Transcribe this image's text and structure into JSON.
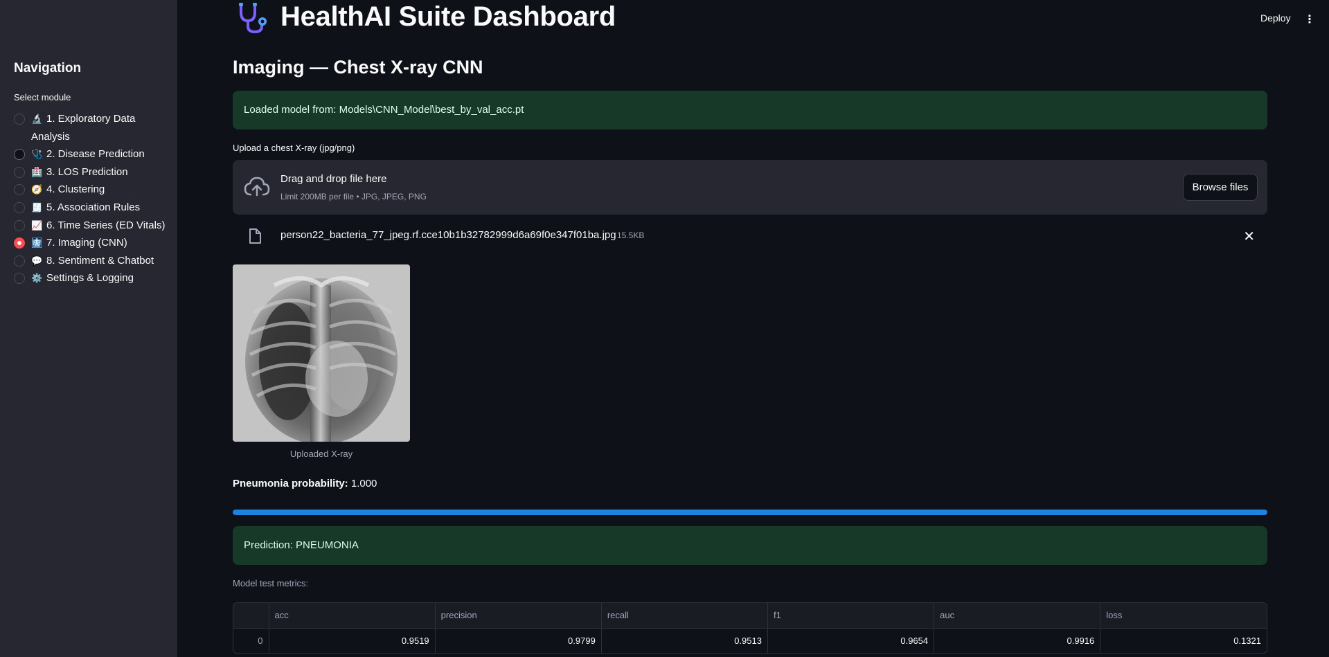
{
  "app": {
    "title": "HealthAI Suite Dashboard",
    "logo_icon": "stethoscope-icon",
    "deploy_label": "Deploy",
    "menu_icon": "kebab-menu-icon"
  },
  "sidebar": {
    "title": "Navigation",
    "select_label": "Select module",
    "selected_index": 6,
    "items": [
      {
        "emoji": "🔬",
        "label": "1. Exploratory Data Analysis"
      },
      {
        "emoji": "🩺",
        "label": "2. Disease Prediction"
      },
      {
        "emoji": "🏥",
        "label": "3. LOS Prediction"
      },
      {
        "emoji": "🧭",
        "label": "4. Clustering"
      },
      {
        "emoji": "🧾",
        "label": "5. Association Rules"
      },
      {
        "emoji": "📈",
        "label": "6. Time Series (ED Vitals)"
      },
      {
        "emoji": "🩻",
        "label": "7. Imaging (CNN)"
      },
      {
        "emoji": "💬",
        "label": "8. Sentiment & Chatbot"
      },
      {
        "emoji": "⚙️",
        "label": "Settings & Logging"
      }
    ]
  },
  "main": {
    "page_title": "Imaging — Chest X-ray CNN",
    "model_loaded_msg": "Loaded model from: Models\\CNN_Model\\best_by_val_acc.pt",
    "upload": {
      "label": "Upload a chest X-ray (jpg/png)",
      "dropzone_title": "Drag and drop file here",
      "dropzone_limit": "Limit 200MB per file • JPG, JPEG, PNG",
      "browse_label": "Browse files",
      "file_name": "person22_bacteria_77_jpeg.rf.cce10b1b32782999d6a69f0e347f01ba.jpg",
      "file_size": "15.5KB"
    },
    "image_caption": "Uploaded X-ray",
    "probability_label": "Pneumonia probability:",
    "probability_value": "1.000",
    "progress_fraction": 1.0,
    "prediction_msg": "Prediction: PNEUMONIA",
    "metrics_label": "Model test metrics:",
    "metrics": {
      "columns": [
        "",
        "acc",
        "precision",
        "recall",
        "f1",
        "auc",
        "loss"
      ],
      "rows": [
        [
          "0",
          "0.9519",
          "0.9799",
          "0.9513",
          "0.9654",
          "0.9916",
          "0.1321"
        ]
      ]
    }
  },
  "colors": {
    "background": "#0e1117",
    "sidebar": "#262730",
    "success_bg": "#173928",
    "progress": "#1c83e1",
    "radio_selected": "#ff4b4b"
  }
}
